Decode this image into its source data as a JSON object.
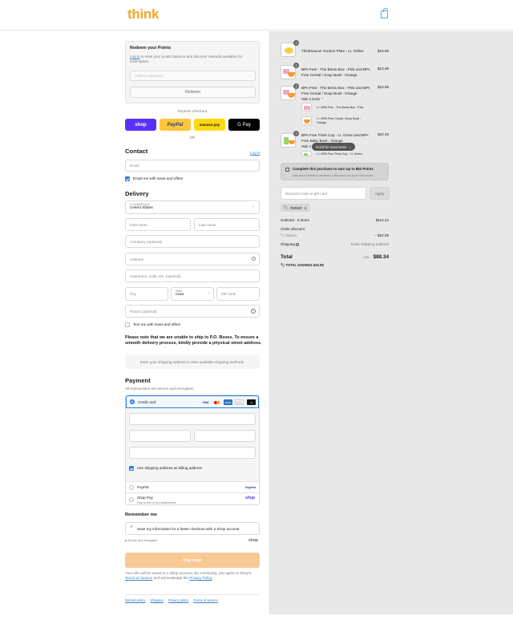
{
  "header": {
    "logo": "think"
  },
  "redeem": {
    "title": "Redeem your Points",
    "login_link": "Log in",
    "description_rest": " to view your points balance and discover rewards available for redemption.",
    "select_placeholder": "Select a discount",
    "button": "Redeem"
  },
  "express": {
    "label": "Express checkout",
    "shop": "shop",
    "paypal": "PayPal",
    "amazon": "amazon pay",
    "gpay": "G Pay",
    "or": "OR"
  },
  "contact": {
    "title": "Contact",
    "login": "Log in",
    "email_placeholder": "Email",
    "news_label": "Email me with news and offers"
  },
  "delivery": {
    "title": "Delivery",
    "country_label": "Country/Region",
    "country_value": "United States",
    "first_name": "First name",
    "last_name": "Last name",
    "company": "Company (optional)",
    "address": "Address",
    "apartment": "Apartment, suite, etc. (optional)",
    "city": "City",
    "state_label": "State",
    "state_value": "Iowa",
    "zip": "ZIP code",
    "phone": "Phone (optional)",
    "text_news": "Text me with news and offers",
    "notice": "Please note that we are unable to ship to P.O. Boxes. To ensure a smooth delivery process, kindly provide a physical street address.",
    "shipping_hint": "Enter your shipping address to view available shipping methods."
  },
  "payment": {
    "title": "Payment",
    "subtitle": "All transactions are secure and encrypted.",
    "credit_card": "Credit card",
    "card_brands": [
      "visa",
      "mc",
      "amex",
      "discover",
      "+4"
    ],
    "billing_label": "Use shipping address as billing address",
    "paypal": "PayPal",
    "paypal_logo": "PayPal",
    "shop_pay": "Shop Pay",
    "shop_pay_sub": "Pay in full or in installments",
    "shop_pay_logo": "shop"
  },
  "remember": {
    "title": "Remember me",
    "save_label": "Save my information for a faster checkout with a Shop account",
    "secure": "Secure and encrypted",
    "shop_logo": "shop"
  },
  "pay_now": "Pay now",
  "legal": {
    "text1": "Your info will be saved to a Shop account. By continuing, you agree to Shop's ",
    "tos": "Terms of Service",
    "text2": " and acknowledge the ",
    "privacy": "Privacy Policy",
    "text3": "."
  },
  "footer_links": [
    "Refund policy",
    "Shipping",
    "Privacy policy",
    "Terms of service"
  ],
  "cart": {
    "items": [
      {
        "qty": "1",
        "name": "ThinkSaucer Suction Plate - Lt. Yellow",
        "price": "$19.99"
      },
      {
        "qty": "1",
        "name": "BPA Free - The Bento Box - Pink and BPA Free Cereal / Soup Bowl - Orange",
        "price": "$23.98"
      },
      {
        "qty": "1",
        "name": "BPA Free - The Bento Box - Pink and BPA Free Cereal / Soup Bowl - Orange",
        "price": "$23.98"
      },
      {
        "qty": "1",
        "name": "BPA Free Think Cup - Lt. Green and BPA Free Baby Bowl - Orange",
        "price": "$20.48"
      }
    ],
    "hide_items": "Hide 2 items",
    "sub_items": [
      "1 × BPA Free - The Bento Box - Pink",
      "1 × BPA Free Cereal / Soup Bowl - Orange"
    ],
    "hide_items_2": "Hide 2",
    "sub_item_3": "1 × BPA Free Think Cup - Lt. Green",
    "scroll_tooltip": "Scroll for more items"
  },
  "points_banner": {
    "title": "Complete this purchase to earn up to 883 Points",
    "subtitle": "Use your Points to redeem a discount on your next order"
  },
  "discount": {
    "placeholder": "Discount code or gift card",
    "apply": "Apply",
    "tag": "RMN20"
  },
  "summary": {
    "subtotal_label": "Subtotal · 5 items",
    "subtotal_value": "$110.42",
    "order_discount_label": "Order discount",
    "code": "RMN20",
    "discount_value": "− $22.08",
    "shipping_label": "Shipping",
    "shipping_value": "Enter shipping address",
    "total_label": "Total",
    "currency": "USD",
    "total_value": "$88.34",
    "savings_label": "TOTAL SAVINGS",
    "savings_value": "$22.08"
  }
}
